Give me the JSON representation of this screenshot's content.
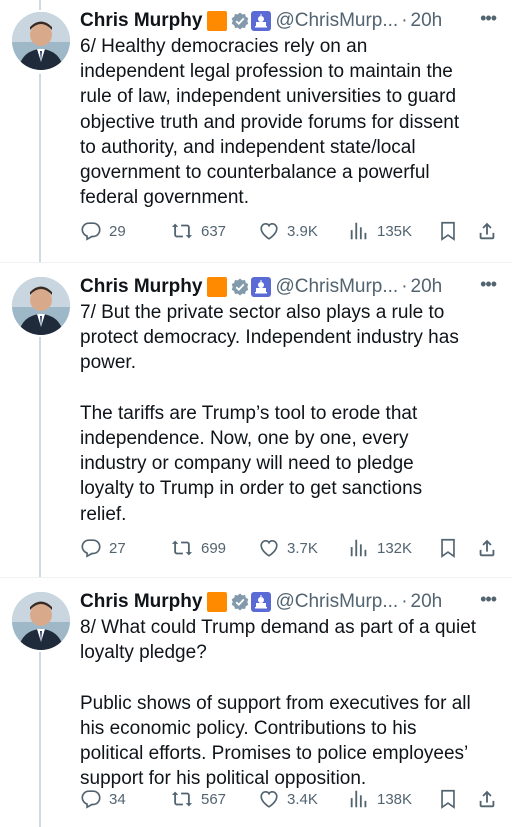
{
  "tweets": [
    {
      "author": {
        "name": "Chris Murphy",
        "handle": "@ChrisMurp...",
        "time": "20h"
      },
      "text": "6/ Healthy democracies rely on an\nindependent legal profession to maintain the\nrule of law, independent universities to guard\nobjective truth and provide forums for dissent\nto authority, and independent state/local\ngovernment to counterbalance a powerful\nfederal government.",
      "stats": {
        "replies": "29",
        "reposts": "637",
        "likes": "3.9K",
        "views": "135K"
      }
    },
    {
      "author": {
        "name": "Chris Murphy",
        "handle": "@ChrisMurp...",
        "time": "20h"
      },
      "text": "7/ But the private sector also plays a rule to\nprotect democracy. Independent industry has\npower.\n\nThe tariffs are Trump’s tool to erode that\nindependence. Now, one by one, every\nindustry or company will need to pledge\nloyalty to Trump in order to get sanctions\nrelief.",
      "stats": {
        "replies": "27",
        "reposts": "699",
        "likes": "3.7K",
        "views": "132K"
      }
    },
    {
      "author": {
        "name": "Chris Murphy",
        "handle": "@ChrisMurp...",
        "time": "20h"
      },
      "text": "8/ What could Trump demand as part of a quiet\nloyalty pledge?\n\nPublic shows of support from executives for all\nhis economic policy. Contributions to his\npolitical efforts. Promises to police employees’\nsupport for his political opposition.",
      "stats": {
        "replies": "34",
        "reposts": "567",
        "likes": "3.4K",
        "views": "138K"
      }
    }
  ],
  "ui": {
    "separator": "·",
    "more_glyph": "•••"
  },
  "icons": {
    "reply": "reply-icon",
    "repost": "repost-icon",
    "like": "like-icon",
    "views": "views-icon",
    "bookmark": "bookmark-icon",
    "share": "share-icon",
    "verified": "verified-badge-icon",
    "flag": "orange-flag-icon",
    "affiliation": "capitol-icon"
  },
  "colors": {
    "text": "#0f1419",
    "muted": "#536471",
    "flag": "#ff8a00",
    "verified": "#829aab",
    "affiliation": "#5b6bd6",
    "thread_line": "#cfd9de"
  }
}
